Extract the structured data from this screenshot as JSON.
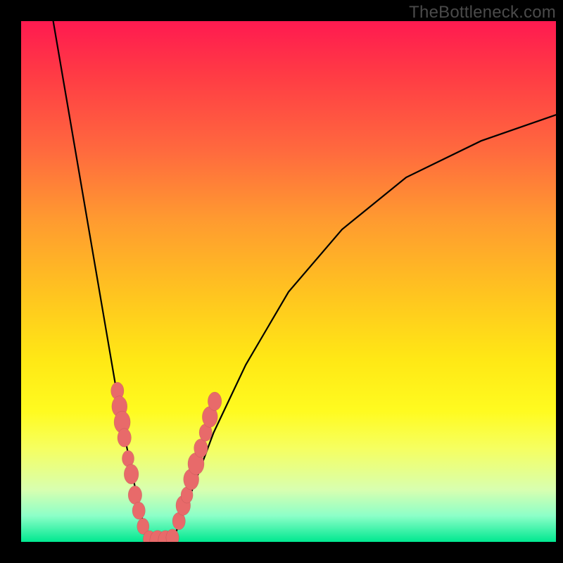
{
  "watermark": "TheBottleneck.com",
  "colors": {
    "gradient_top": "#ff1a50",
    "gradient_mid": "#ffe815",
    "gradient_bottom": "#00e890",
    "curve": "#000000",
    "beads": "#e86a6a",
    "frame": "#000000"
  },
  "chart_data": {
    "type": "line",
    "title": "",
    "xlabel": "",
    "ylabel": "",
    "xlim": [
      0,
      100
    ],
    "ylim": [
      0,
      100
    ],
    "grid": false,
    "legend": false,
    "description": "Bottleneck-style curve: steep descent from top-left to a minimum near x≈24, flat segment, then shallower rise toward upper-right. Background is a vertical rainbow gradient (red→yellow→green). Salmon-colored bead clusters sit on both arms of the V near the bottom.",
    "series": [
      {
        "name": "left_arm",
        "x": [
          6,
          8,
          10,
          12,
          14,
          16,
          18,
          19,
          20,
          21,
          22,
          23
        ],
        "y": [
          100,
          88,
          76,
          64,
          52,
          40,
          28,
          22,
          17,
          12,
          7,
          3
        ]
      },
      {
        "name": "trough",
        "x": [
          23,
          24,
          25,
          26,
          27,
          28,
          29
        ],
        "y": [
          3,
          1,
          0,
          0,
          0,
          1,
          2
        ]
      },
      {
        "name": "right_arm",
        "x": [
          29,
          32,
          36,
          42,
          50,
          60,
          72,
          86,
          100
        ],
        "y": [
          2,
          10,
          21,
          34,
          48,
          60,
          70,
          77,
          82
        ]
      }
    ],
    "beads_left": [
      {
        "x": 18.0,
        "y": 29,
        "r": 1.5
      },
      {
        "x": 18.4,
        "y": 26,
        "r": 1.8
      },
      {
        "x": 18.9,
        "y": 23,
        "r": 1.9
      },
      {
        "x": 19.3,
        "y": 20,
        "r": 1.6
      },
      {
        "x": 20.0,
        "y": 16,
        "r": 1.4
      },
      {
        "x": 20.6,
        "y": 13,
        "r": 1.7
      },
      {
        "x": 21.3,
        "y": 9,
        "r": 1.6
      },
      {
        "x": 22.0,
        "y": 6,
        "r": 1.5
      },
      {
        "x": 22.8,
        "y": 3,
        "r": 1.4
      }
    ],
    "beads_trough": [
      {
        "x": 24.0,
        "y": 0.5,
        "r": 1.5
      },
      {
        "x": 25.5,
        "y": 0.2,
        "r": 1.8
      },
      {
        "x": 27.0,
        "y": 0.3,
        "r": 1.7
      },
      {
        "x": 28.3,
        "y": 0.8,
        "r": 1.5
      }
    ],
    "beads_right": [
      {
        "x": 29.5,
        "y": 4,
        "r": 1.5
      },
      {
        "x": 30.3,
        "y": 7,
        "r": 1.7
      },
      {
        "x": 31.0,
        "y": 9,
        "r": 1.4
      },
      {
        "x": 31.8,
        "y": 12,
        "r": 1.8
      },
      {
        "x": 32.7,
        "y": 15,
        "r": 1.9
      },
      {
        "x": 33.6,
        "y": 18,
        "r": 1.6
      },
      {
        "x": 34.5,
        "y": 21,
        "r": 1.5
      },
      {
        "x": 35.3,
        "y": 24,
        "r": 1.8
      },
      {
        "x": 36.2,
        "y": 27,
        "r": 1.6
      }
    ]
  }
}
